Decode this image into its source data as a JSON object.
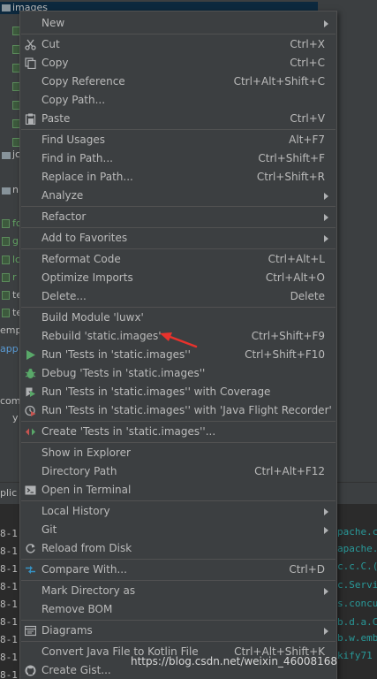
{
  "background": {
    "selected_folder": "images",
    "tree_texts": [
      "jc",
      "n",
      "fc",
      "g",
      "lc",
      "r",
      "te",
      "te",
      "emp",
      "app",
      "com",
      "y"
    ],
    "bottom_tab": "plic",
    "log_left": [
      "8-1",
      "8-1",
      "8-1",
      "8-1",
      "8-1",
      "8-1",
      "8-1",
      "8-1",
      "8-1",
      "8-1",
      "8-1"
    ],
    "log_right": [
      "pache.ca",
      "apache.",
      "c.c.C.(",
      "c.Servi",
      "s.concu",
      "b.d.a.C",
      "b.w.emb",
      "c.c.C.(",
      "kify71",
      "c.c.c.("
    ]
  },
  "watermark": "https://blog.csdn.net/weixin_46008168",
  "colors": {
    "menu_bg": "#3c3f41",
    "menu_border": "#515151",
    "text": "#bbbbbb",
    "annotation_arrow": "#e8322c"
  },
  "menu": {
    "new": "New",
    "cut": "Cut",
    "cut_sc": "Ctrl+X",
    "copy": "Copy",
    "copy_sc": "Ctrl+C",
    "copy_ref": "Copy Reference",
    "copy_ref_sc": "Ctrl+Alt+Shift+C",
    "copy_path": "Copy Path...",
    "paste": "Paste",
    "paste_sc": "Ctrl+V",
    "find_usages": "Find Usages",
    "find_usages_sc": "Alt+F7",
    "find_in_path": "Find in Path...",
    "find_in_path_sc": "Ctrl+Shift+F",
    "replace_in_path": "Replace in Path...",
    "replace_in_path_sc": "Ctrl+Shift+R",
    "analyze": "Analyze",
    "refactor": "Refactor",
    "add_fav": "Add to Favorites",
    "reformat": "Reformat Code",
    "reformat_sc": "Ctrl+Alt+L",
    "optimize": "Optimize Imports",
    "optimize_sc": "Ctrl+Alt+O",
    "delete": "Delete...",
    "delete_sc": "Delete",
    "build_module": "Build Module 'luwx'",
    "rebuild": "Rebuild 'static.images'",
    "rebuild_sc": "Ctrl+Shift+F9",
    "run_tests": "Run 'Tests in 'static.images''",
    "run_tests_sc": "Ctrl+Shift+F10",
    "debug_tests": "Debug 'Tests in 'static.images''",
    "run_coverage": "Run 'Tests in 'static.images'' with Coverage",
    "run_jfr": "Run 'Tests in 'static.images'' with 'Java Flight Recorder'",
    "create_tests": "Create 'Tests in 'static.images''...",
    "show_explorer": "Show in Explorer",
    "dir_path": "Directory Path",
    "dir_path_sc": "Ctrl+Alt+F12",
    "open_terminal": "Open in Terminal",
    "local_history": "Local History",
    "git": "Git",
    "reload": "Reload from Disk",
    "compare": "Compare With...",
    "compare_sc": "Ctrl+D",
    "mark_dir": "Mark Directory as",
    "remove_bom": "Remove BOM",
    "diagrams": "Diagrams",
    "convert_kotlin": "Convert Java File to Kotlin File",
    "convert_kotlin_sc": "Ctrl+Alt+Shift+K",
    "create_gist": "Create Gist..."
  }
}
